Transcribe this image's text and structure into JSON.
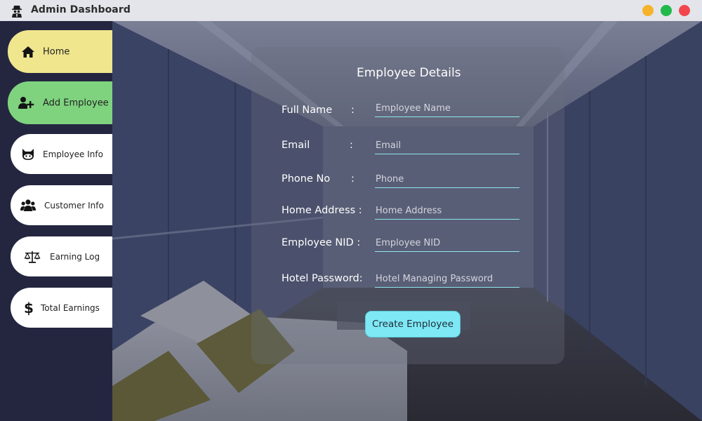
{
  "window": {
    "title": "Admin Dashboard",
    "controls": [
      "minimize",
      "maximize",
      "close"
    ],
    "control_colors": {
      "minimize": "#f6b32a",
      "maximize": "#22b94c",
      "close": "#f2474c"
    }
  },
  "sidebar": {
    "items": [
      {
        "label": "Home",
        "icon": "home-icon",
        "color": "#f0e68e"
      },
      {
        "label": "Add Employee",
        "icon": "add-user-icon",
        "color": "#7fd37f"
      },
      {
        "label": "Employee Info",
        "icon": "cat-icon",
        "color": "#ffffff"
      },
      {
        "label": "Customer Info",
        "icon": "users-icon",
        "color": "#ffffff"
      },
      {
        "label": "Earning Log",
        "icon": "balance-scale-icon",
        "color": "#ffffff"
      },
      {
        "label": "Total Earnings",
        "icon": "dollar-icon",
        "color": "#ffffff"
      }
    ]
  },
  "form": {
    "title": "Employee Details",
    "fields": [
      {
        "label": "Full Name",
        "colon": ":",
        "placeholder": "Employee Name"
      },
      {
        "label": "Email",
        "colon": ":",
        "placeholder": "Email"
      },
      {
        "label": "Phone No",
        "colon": ":",
        "placeholder": "Phone"
      },
      {
        "label": "Home Address :",
        "colon": "",
        "placeholder": "Home Address"
      },
      {
        "label": "Employee NID :",
        "colon": "",
        "placeholder": "Employee NID"
      },
      {
        "label": "Hotel Password:",
        "colon": "",
        "placeholder": "Hotel Managing Password"
      }
    ],
    "submit_label": "Create Employee",
    "accent_color": "#7ee9f5"
  }
}
